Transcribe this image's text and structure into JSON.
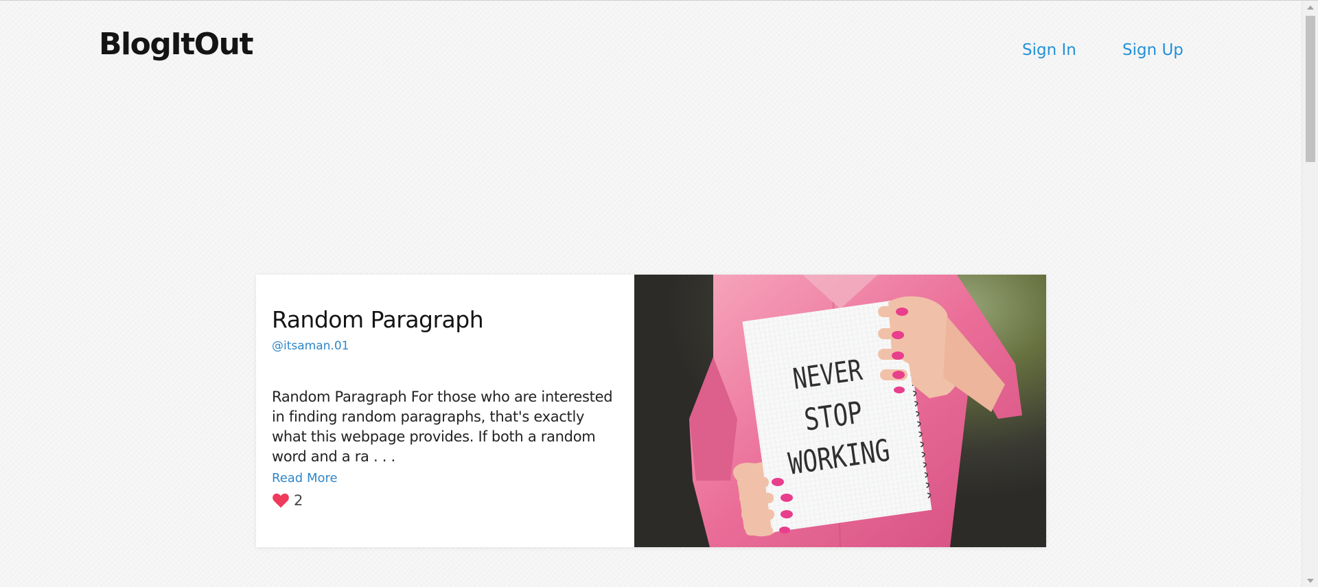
{
  "header": {
    "brand": "BlogItOut",
    "nav": {
      "sign_in": "Sign In",
      "sign_up": "Sign Up"
    }
  },
  "post": {
    "title": "Random Paragraph",
    "author": "@itsaman.01",
    "excerpt": "Random Paragraph For those who are interested in finding random paragraphs, that's exactly what this webpage provides. If both a random word and a ra . . .",
    "read_more": "Read More",
    "likes": "2",
    "image": {
      "notebook_lines": [
        "NEVER",
        "STOP",
        "WORKING"
      ]
    }
  },
  "icons": {
    "like": "heart-icon"
  },
  "colors": {
    "link": "#2391d8",
    "heart": "#ee3b5b"
  }
}
